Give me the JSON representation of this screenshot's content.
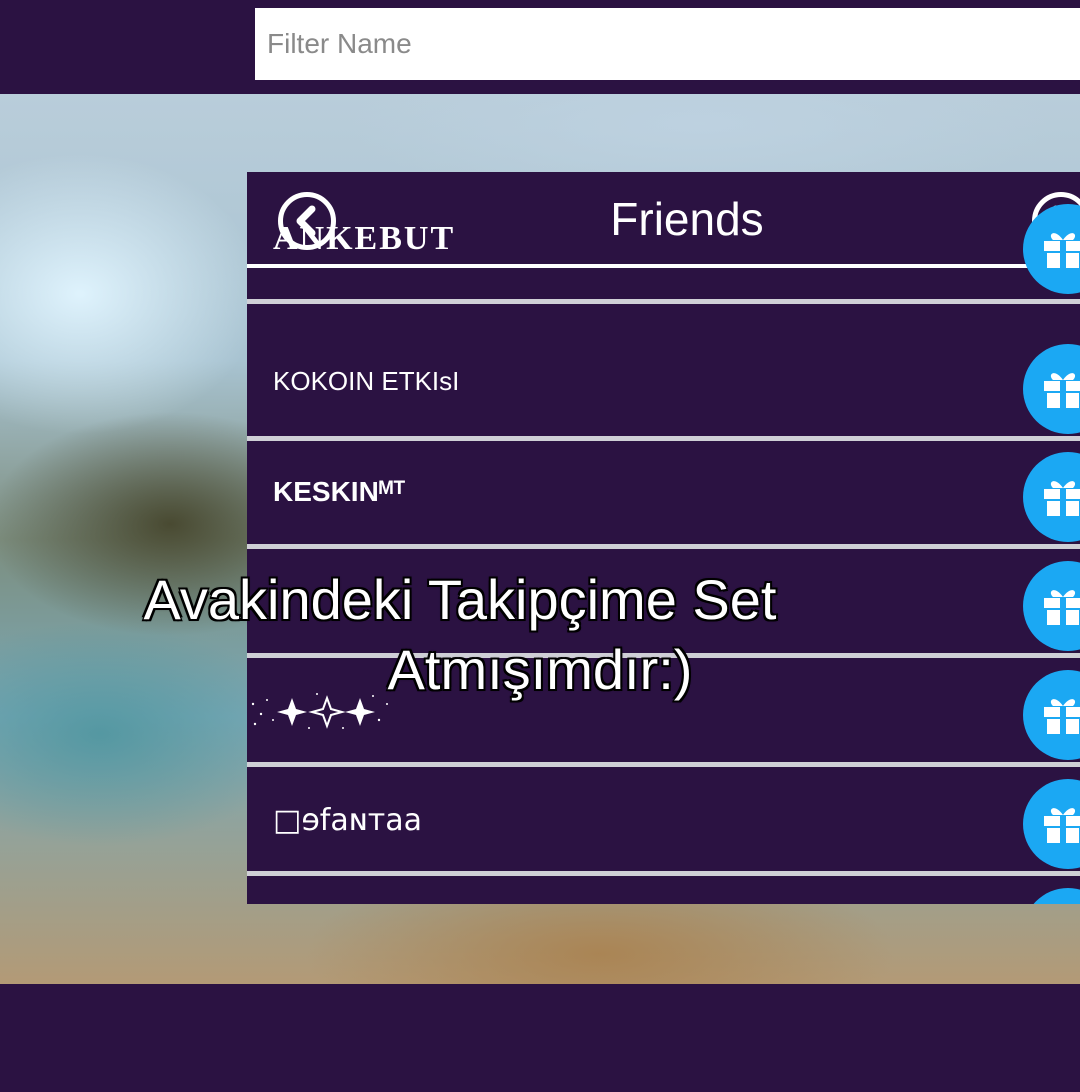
{
  "search": {
    "placeholder": "Filter Name"
  },
  "panel": {
    "title": "Friends",
    "prev_icon": "chevron-left-icon",
    "next_icon": "chevron-right-icon"
  },
  "friends": [
    {
      "name": "ANKEBUT"
    },
    {
      "name": "KOKOIN ETKIsI"
    },
    {
      "name": "KESKINᴹᵀ"
    },
    {
      "name": ""
    },
    {
      "name": ""
    },
    {
      "name": "□ɘfaɴтaa"
    },
    {
      "name": ""
    }
  ],
  "row_action_icon": "gift-icon",
  "caption": {
    "line1": "Avakindeki Takipçime Set",
    "line2": "Atmışımdır:)"
  },
  "colors": {
    "background": "#2b1242",
    "panel": "#2b1242",
    "gift_button": "#1ba8f3",
    "divider": "#cfcfd6"
  }
}
